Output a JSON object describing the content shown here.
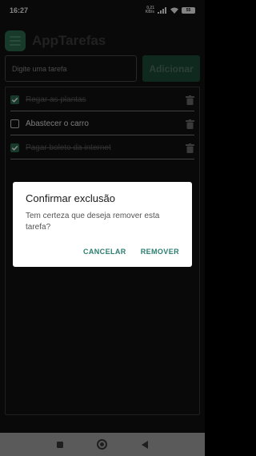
{
  "status_bar": {
    "time": "16:27",
    "net_speed_value": "0,21",
    "net_speed_unit": "KB/s",
    "signal_label": "4G",
    "battery": "55"
  },
  "app": {
    "title": "AppTarefas",
    "input_placeholder": "Digite uma tarefa",
    "input_value": "",
    "add_button_label": "Adicionar"
  },
  "tasks": [
    {
      "text": "Regar as plantas",
      "done": true
    },
    {
      "text": "Abastecer o carro",
      "done": false
    },
    {
      "text": "Pagar boleto da internet",
      "done": true
    }
  ],
  "dialog": {
    "title": "Confirmar exclusão",
    "message": "Tem certeza que deseja remover esta tarefa?",
    "cancel_label": "CANCELAR",
    "remove_label": "REMOVER"
  },
  "colors": {
    "accent": "#2a6a4d",
    "dialog_button": "#2a7d6f"
  }
}
